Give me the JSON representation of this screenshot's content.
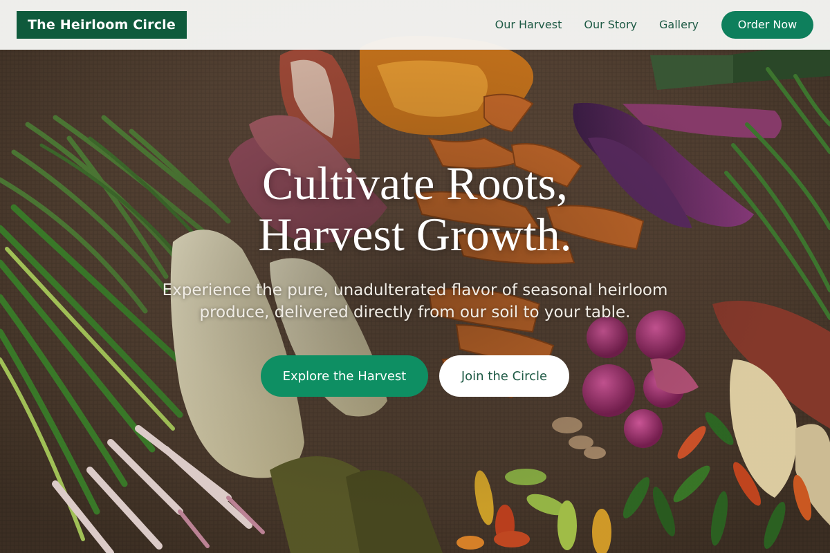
{
  "brand": {
    "name": "The Heirloom Circle",
    "accent": "#0f5a3c"
  },
  "nav": {
    "links": [
      "Our Harvest",
      "Our Story",
      "Gallery"
    ],
    "cta_label": "Order Now",
    "cta_color": "#0e7f5c"
  },
  "hero": {
    "headline_line1": "Cultivate Roots,",
    "headline_line2": "Harvest Growth.",
    "subtitle_line1": "Experience the pure, unadulterated flavor of seasonal heirloom",
    "subtitle_line2": "produce, delivered directly from our soil to your table.",
    "primary_cta": "Explore the Harvest",
    "secondary_cta": "Join the Circle",
    "primary_color": "#0e8f63",
    "background_image": "vegetables-on-burlap-photo"
  }
}
